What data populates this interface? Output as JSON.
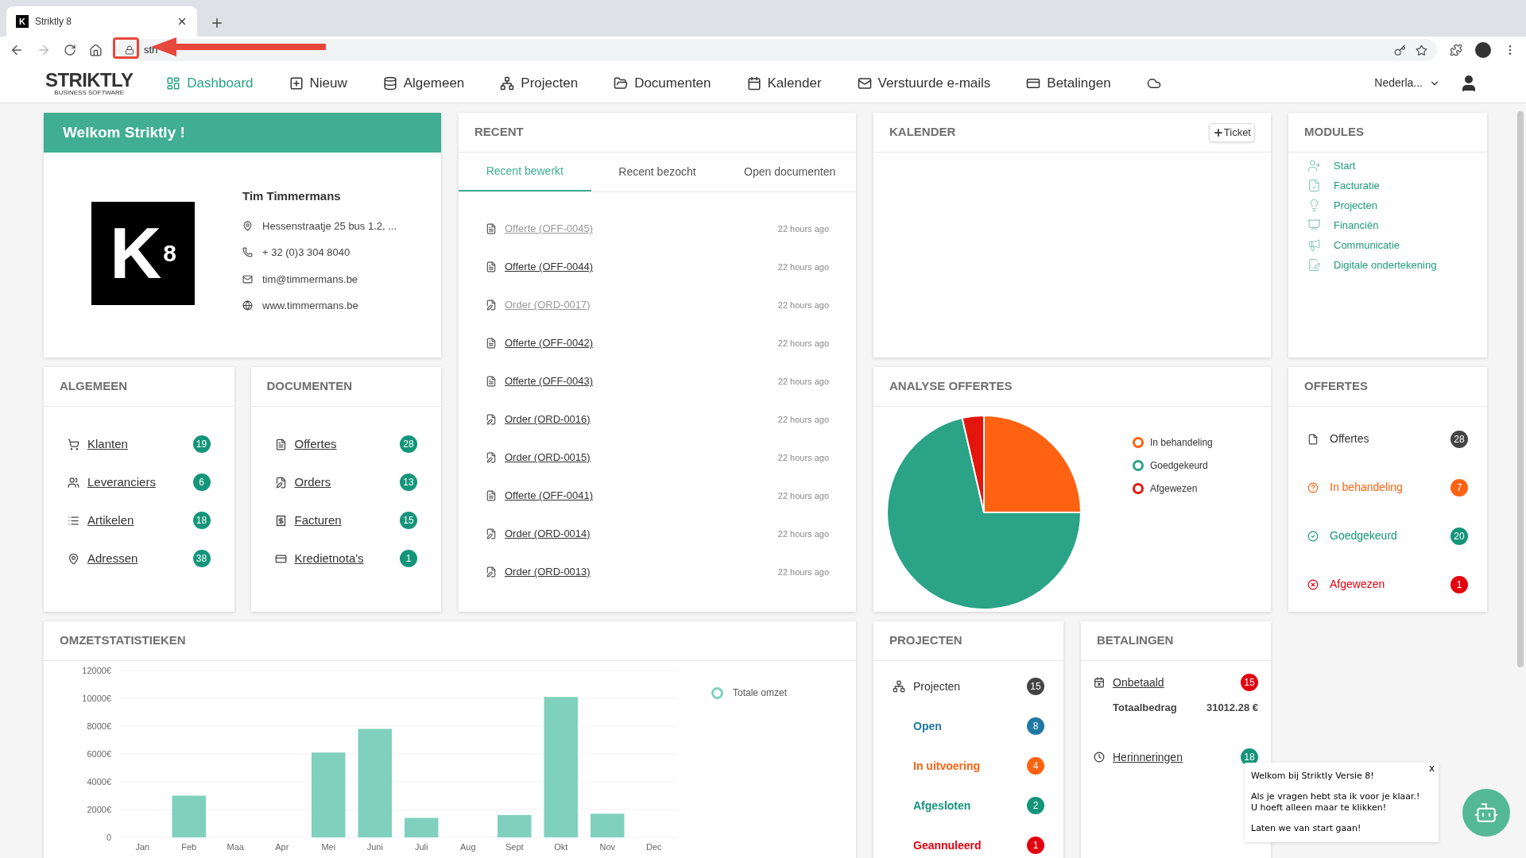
{
  "browser": {
    "tab_title": "Striktly 8",
    "favicon": "K",
    "url": "stri"
  },
  "app_nav": {
    "brand": "STRIKTLY",
    "brand_sub": "BUSINESS SOFTWARE",
    "items": [
      {
        "kind": "dashboard",
        "label": "Dashboard",
        "selected": true
      },
      {
        "kind": "new",
        "label": "Nieuw",
        "selected": false
      },
      {
        "kind": "general",
        "label": "Algemeen",
        "selected": false
      },
      {
        "kind": "projects",
        "label": "Projecten",
        "selected": false
      },
      {
        "kind": "documents",
        "label": "Documenten",
        "selected": false
      },
      {
        "kind": "calendar",
        "label": "Kalender",
        "selected": false
      },
      {
        "kind": "mail",
        "label": "Verstuurde e-mails",
        "selected": false
      },
      {
        "kind": "payments",
        "label": "Betalingen",
        "selected": false
      },
      {
        "kind": "cloud",
        "selected": false
      }
    ],
    "language": "Nederla..."
  },
  "welcome": {
    "title": "Welkom Striktly !",
    "logo_letter": "K",
    "logo_digit": "8",
    "name": "Tim Timmermans",
    "details": [
      {
        "kind": "address",
        "text": "Hessenstraatje 25 bus 1.2, ..."
      },
      {
        "kind": "phone",
        "text": "+ 32 (0)3 304 8040"
      },
      {
        "kind": "email",
        "text": "tim@timmermans.be"
      },
      {
        "kind": "web",
        "text": "www.timmermans.be"
      }
    ]
  },
  "algemeen": {
    "title": "ALGEMEEN",
    "items": [
      {
        "kind": "cart",
        "label": "Klanten",
        "count": "19"
      },
      {
        "kind": "people",
        "label": "Leveranciers",
        "count": "6"
      },
      {
        "kind": "list",
        "label": "Artikelen",
        "count": "18"
      },
      {
        "kind": "pin",
        "label": "Adressen",
        "count": "38"
      }
    ]
  },
  "documenten": {
    "title": "DOCUMENTEN",
    "items": [
      {
        "kind": "file",
        "label": "Offertes",
        "count": "28"
      },
      {
        "kind": "order",
        "label": "Orders",
        "count": "13"
      },
      {
        "kind": "invoice",
        "label": "Facturen",
        "count": "15"
      },
      {
        "kind": "card",
        "label": "Kredietnota's",
        "count": "1"
      }
    ]
  },
  "recent": {
    "title": "RECENT",
    "tabs": [
      {
        "label": "Recent bewerkt",
        "selected": true
      },
      {
        "label": "Recent bezocht",
        "selected": false
      },
      {
        "label": "Open documenten",
        "selected": false
      }
    ],
    "items": [
      {
        "kind": "offerte",
        "label": "Offerte (OFF-0045)",
        "deleted": true,
        "time": "22 hours ago"
      },
      {
        "kind": "offerte",
        "label": "Offerte (OFF-0044)",
        "deleted": false,
        "time": "22 hours ago"
      },
      {
        "kind": "order",
        "label": "Order (ORD-0017)",
        "deleted": true,
        "time": "22 hours ago"
      },
      {
        "kind": "offerte",
        "label": "Offerte (OFF-0042)",
        "deleted": false,
        "time": "22 hours ago"
      },
      {
        "kind": "offerte",
        "label": "Offerte (OFF-0043)",
        "deleted": false,
        "time": "22 hours ago"
      },
      {
        "kind": "order",
        "label": "Order (ORD-0016)",
        "deleted": false,
        "time": "22 hours ago"
      },
      {
        "kind": "order",
        "label": "Order (ORD-0015)",
        "deleted": false,
        "time": "22 hours ago"
      },
      {
        "kind": "offerte",
        "label": "Offerte (OFF-0041)",
        "deleted": false,
        "time": "22 hours ago"
      },
      {
        "kind": "order",
        "label": "Order (ORD-0014)",
        "deleted": false,
        "time": "22 hours ago"
      },
      {
        "kind": "order",
        "label": "Order (ORD-0013)",
        "deleted": false,
        "time": "22 hours ago"
      }
    ]
  },
  "kalender": {
    "title": "KALENDER",
    "button": "Ticket"
  },
  "modules": {
    "title": "MODULES",
    "items": [
      {
        "kind": "start",
        "label": "Start"
      },
      {
        "kind": "billing",
        "label": "Facturatie"
      },
      {
        "kind": "projects",
        "label": "Projecten"
      },
      {
        "kind": "finance",
        "label": "Financiën"
      },
      {
        "kind": "communication",
        "label": "Communicatie"
      },
      {
        "kind": "signing",
        "label": "Digitale ondertekening"
      }
    ]
  },
  "analyse": {
    "title": "ANALYSE OFFERTES",
    "chart_data": {
      "type": "pie",
      "categories": [
        "In behandeling",
        "Goedgekeurd",
        "Afgewezen"
      ],
      "values": [
        25,
        71.4,
        3.6
      ],
      "colors": [
        "#ff6210",
        "#2aa386",
        "#e3150c"
      ]
    }
  },
  "offertes": {
    "title": "OFFERTES",
    "items": [
      {
        "kind": "total",
        "label": "Offertes",
        "count": "28",
        "color": "#444444"
      },
      {
        "kind": "pending",
        "label": "In behandeling",
        "count": "7",
        "color": "#ff6210"
      },
      {
        "kind": "approved",
        "label": "Goedgekeurd",
        "count": "20",
        "color": "#14957a"
      },
      {
        "kind": "rejected",
        "label": "Afgewezen",
        "count": "1",
        "color": "#e3000f"
      }
    ]
  },
  "omzet": {
    "title": "OMZETSTATISTIEKEN",
    "chart_data": {
      "type": "bar",
      "categories": [
        "Jan",
        "Feb",
        "Maa",
        "Apr",
        "Mei",
        "Juni",
        "Juli",
        "Aug",
        "Sept",
        "Okt",
        "Nov",
        "Dec"
      ],
      "series": [
        {
          "name": "Totale omzet",
          "color": "#7fd1bd",
          "values": [
            0,
            3000,
            0,
            0,
            6100,
            7800,
            1400,
            0,
            1600,
            10100,
            1700,
            0
          ]
        }
      ],
      "grid": true,
      "ylim": [
        0,
        12000
      ],
      "yticks": [
        {
          "value": 0,
          "label": "0"
        },
        {
          "value": 2000,
          "label": "2000€"
        },
        {
          "value": 4000,
          "label": "4000€"
        },
        {
          "value": 6000,
          "label": "6000€"
        },
        {
          "value": 8000,
          "label": "8000€"
        },
        {
          "value": 10000,
          "label": "10000€"
        },
        {
          "value": 12000,
          "label": "12000€"
        }
      ]
    }
  },
  "projecten": {
    "title": "PROJECTEN",
    "items": [
      {
        "kind": "total",
        "label": "Projecten",
        "count": "15",
        "color": "#444444"
      },
      {
        "kind": "status",
        "label": "Open",
        "count": "8",
        "color": "#1f78a4"
      },
      {
        "kind": "status",
        "label": "In uitvoering",
        "count": "4",
        "color": "#ff6210"
      },
      {
        "kind": "status",
        "label": "Afgesloten",
        "count": "2",
        "color": "#14957a"
      },
      {
        "kind": "status",
        "label": "Geannuleerd",
        "count": "1",
        "color": "#e3000f"
      }
    ]
  },
  "betalingen": {
    "title": "BETALINGEN",
    "unpaid": {
      "label": "Onbetaald",
      "count": "15"
    },
    "total_label": "Totaalbedrag",
    "total_value": "31012.28 €",
    "reminders": {
      "label": "Herinneringen",
      "count": "18"
    }
  },
  "chat": {
    "close": "x",
    "lines": [
      "Welkom bij Striktly Versie 8!",
      "Als je vragen hebt sta ik voor je klaar.!",
      "U hoeft alleen maar te klikken!",
      "Laten we van start gaan!"
    ]
  }
}
